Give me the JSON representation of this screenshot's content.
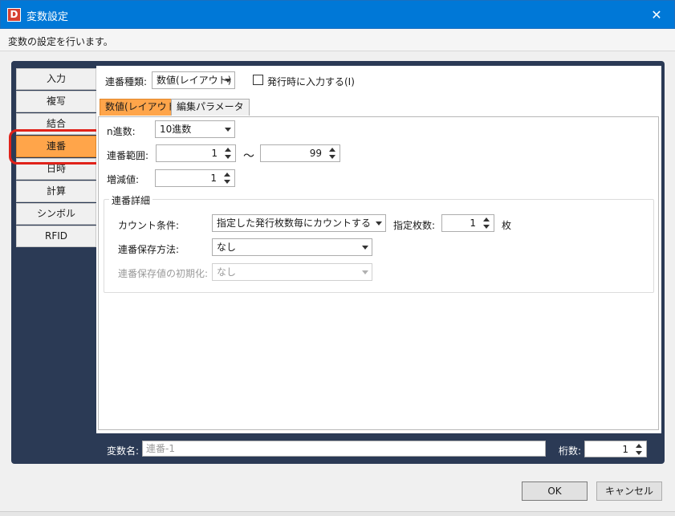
{
  "window": {
    "app_icon_letter": "D",
    "title": "変数設定",
    "close_glyph": "✕",
    "subtitle": "変数の設定を行います。"
  },
  "sidebar": {
    "items": [
      {
        "label": "入力"
      },
      {
        "label": "複写"
      },
      {
        "label": "結合"
      },
      {
        "label": "連番"
      },
      {
        "label": "日時"
      },
      {
        "label": "計算"
      },
      {
        "label": "シンボル"
      },
      {
        "label": "RFID"
      }
    ],
    "selected": "連番",
    "active_color": "#ffa54a",
    "highlight_color": "#e0221a"
  },
  "top": {
    "type_label": "連番種類:",
    "type_value": "数値(レイアウト)",
    "input_on_issue_label": "発行時に入力する(I)",
    "input_on_issue_checked": false
  },
  "tabs": [
    {
      "label": "数値(レイアウト)"
    },
    {
      "label": "編集パラメータ"
    }
  ],
  "form": {
    "base_label": "n進数:",
    "base_value": "10進数",
    "range_label": "連番範囲:",
    "range_from": "1",
    "range_sep": "～",
    "range_to": "99",
    "step_label": "増減値:",
    "step_value": "1"
  },
  "detail": {
    "legend": "連番詳細",
    "count_cond_label": "カウント条件:",
    "count_cond_value": "指定した発行枚数毎にカウントする",
    "sheets_label": "指定枚数:",
    "sheets_value": "1",
    "sheets_unit": "枚",
    "save_method_label": "連番保存方法:",
    "save_method_value": "なし",
    "init_label": "連番保存値の初期化:",
    "init_value": "なし"
  },
  "footer": {
    "var_name_label": "変数名:",
    "var_name_placeholder": "連番-1",
    "digits_label": "桁数:",
    "digits_value": "1"
  },
  "buttons": {
    "ok": "OK",
    "cancel": "キャンセル"
  },
  "colors": {
    "titlebar": "#0078d7",
    "frame": "#2b3a55",
    "accent": "#ffa54a"
  }
}
